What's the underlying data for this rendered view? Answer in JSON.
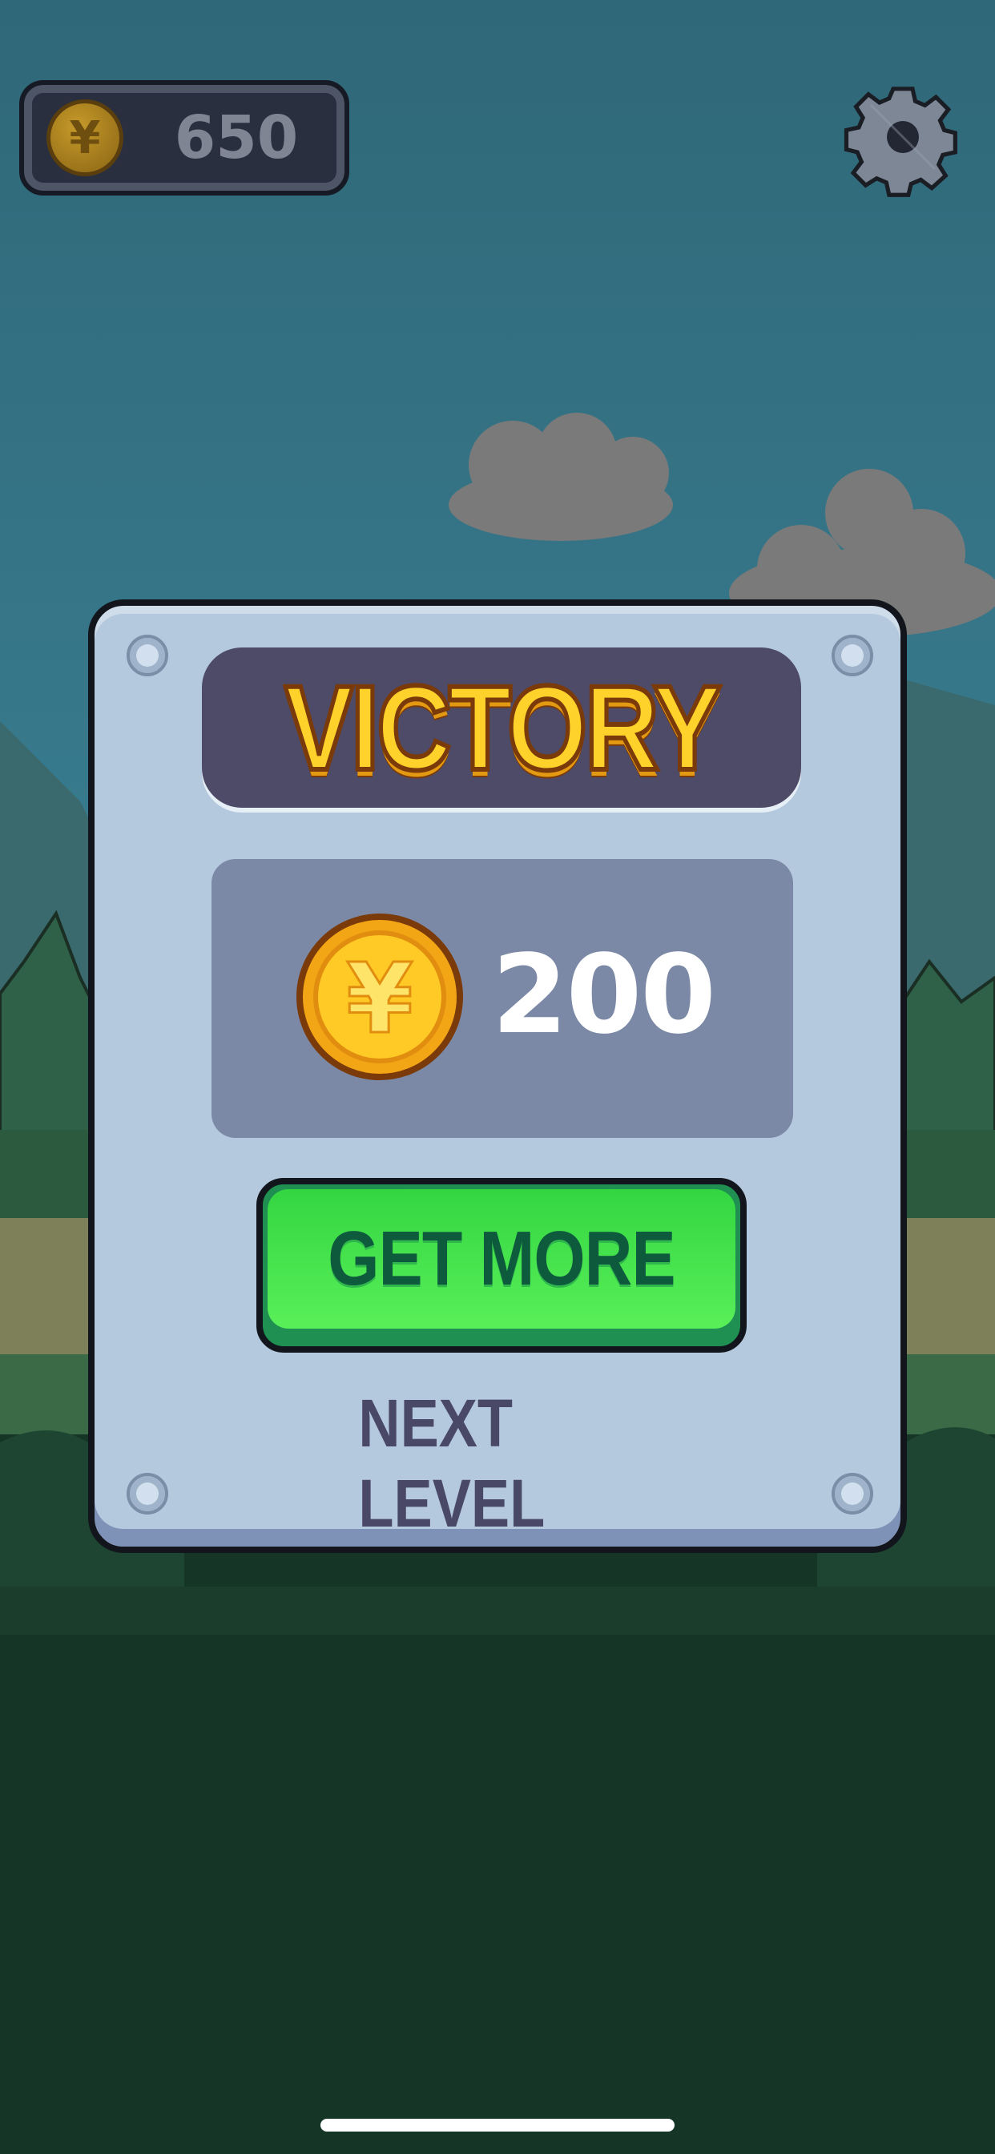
{
  "hud": {
    "coin_balance": "650",
    "coin_icon": "yen-coin-icon",
    "settings_icon": "gear-icon"
  },
  "dialog": {
    "title": "VICTORY",
    "reward": {
      "icon": "yen-coin-icon",
      "amount": "200"
    },
    "get_more_label": "GET MORE",
    "next_level_label": "NEXT LEVEL"
  },
  "colors": {
    "sky": "#2e6a7d",
    "dialog": "#b5c9de",
    "title_gold": "#ffd12b",
    "button_green": "#3ee04a",
    "text_dark": "#4a4867"
  }
}
